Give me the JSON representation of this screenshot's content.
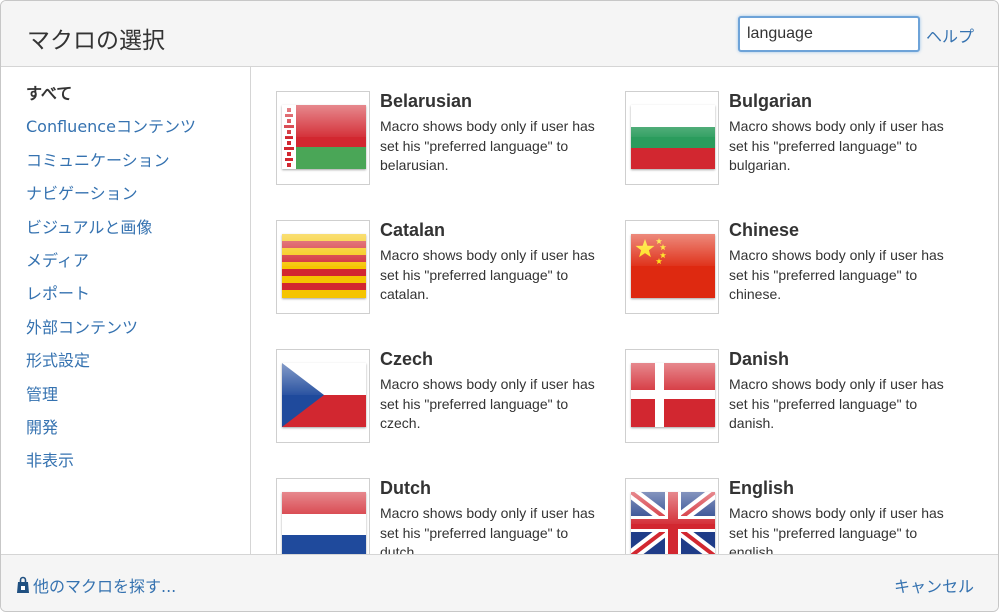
{
  "dialog": {
    "title": "マクロの選択",
    "search_value": "language",
    "help_label": "ヘルプ"
  },
  "sidebar": {
    "items": [
      {
        "label": "すべて",
        "selected": true
      },
      {
        "label": "Confluenceコンテンツ"
      },
      {
        "label": "コミュニケーション"
      },
      {
        "label": "ナビゲーション"
      },
      {
        "label": "ビジュアルと画像"
      },
      {
        "label": "メディア"
      },
      {
        "label": "レポート"
      },
      {
        "label": "外部コンテンツ"
      },
      {
        "label": "形式設定"
      },
      {
        "label": "管理"
      },
      {
        "label": "開発"
      },
      {
        "label": "非表示"
      }
    ]
  },
  "macros": [
    {
      "name": "Belarusian",
      "desc": "Macro shows body only if user has set his \"preferred language\" to belarusian.",
      "flag": "belarus-flag-icon"
    },
    {
      "name": "Bulgarian",
      "desc": "Macro shows body only if user has set his \"preferred language\" to bulgarian.",
      "flag": "bulgaria-flag-icon"
    },
    {
      "name": "Catalan",
      "desc": "Macro shows body only if user has set his \"preferred language\" to catalan.",
      "flag": "catalonia-flag-icon"
    },
    {
      "name": "Chinese",
      "desc": "Macro shows body only if user has set his \"preferred language\" to chinese.",
      "flag": "china-flag-icon"
    },
    {
      "name": "Czech",
      "desc": "Macro shows body only if user has set his \"preferred language\" to czech.",
      "flag": "czech-flag-icon"
    },
    {
      "name": "Danish",
      "desc": "Macro shows body only if user has set his \"preferred language\" to danish.",
      "flag": "denmark-flag-icon"
    },
    {
      "name": "Dutch",
      "desc": "Macro shows body only if user has set his \"preferred language\" to dutch.",
      "flag": "netherlands-flag-icon"
    },
    {
      "name": "English",
      "desc": "Macro shows body only if user has set his \"preferred language\" to english.",
      "flag": "uk-flag-icon"
    }
  ],
  "footer": {
    "more_label": "他のマクロを探す...",
    "cancel_label": "キャンセル"
  },
  "colors": {
    "link": "#3572b0",
    "header_bg": "#f5f5f5"
  }
}
